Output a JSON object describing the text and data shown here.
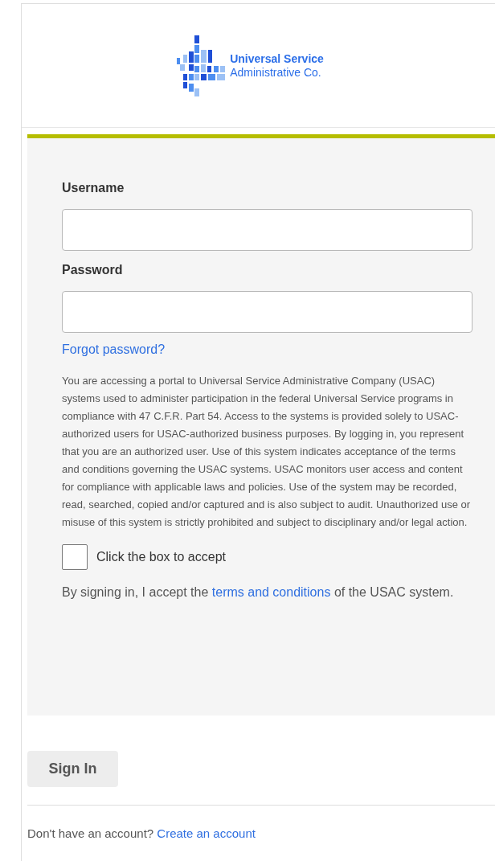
{
  "logo": {
    "line_1": "Universal Service",
    "line_2": "Administrative Co."
  },
  "form": {
    "username": {
      "label": "Username"
    },
    "password": {
      "label": "Password"
    },
    "forgot_link": "Forgot password?",
    "disclaimer": "You are accessing a portal to Universal Service Administrative Company (USAC) systems used to administer participation in the federal Universal Service programs in compliance with 47 C.F.R. Part 54. Access to the systems is provided solely to USAC-authorized users for USAC-authorized business purposes. By logging in, you represent that you are an authorized user. Use of this system indicates acceptance of the terms and conditions governing the USAC systems. USAC monitors user access and content for compliance with applicable laws and policies. Use of the system may be recorded, read, searched, copied and/or captured and is also subject to audit. Unauthorized use or misuse of this system is strictly prohibited and subject to disciplinary and/or legal action.",
    "accept": {
      "label": "Click the box to accept",
      "checked": false
    },
    "terms": {
      "before": "By signing in, I accept the",
      "link": "terms and conditions",
      "after": "of the USAC system."
    }
  },
  "sign_in_button": "Sign In",
  "footer": {
    "text": "Don't have an account?",
    "link": "Create an account"
  }
}
